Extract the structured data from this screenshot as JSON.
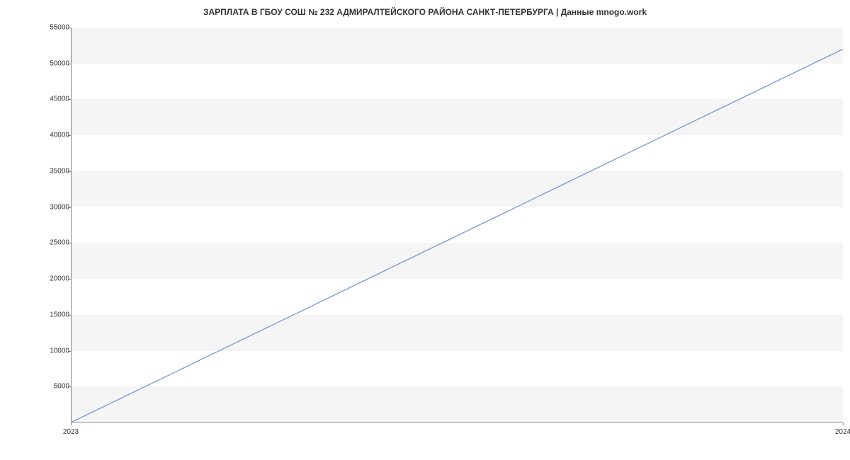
{
  "chart_data": {
    "type": "line",
    "title": "ЗАРПЛАТА В ГБОУ СОШ № 232 АДМИРАЛТЕЙСКОГО РАЙОНА САНКТ-ПЕТЕРБУРГА | Данные mnogo.work",
    "x": [
      2023,
      2024
    ],
    "values": [
      0,
      52000
    ],
    "xlabel": "",
    "ylabel": "",
    "xlim": [
      2023,
      2024
    ],
    "ylim": [
      0,
      55000
    ],
    "x_ticks": [
      "2023",
      "2024"
    ],
    "y_ticks": [
      5000,
      10000,
      15000,
      20000,
      25000,
      30000,
      35000,
      40000,
      45000,
      50000,
      55000
    ],
    "line_color": "#6b8fd6"
  }
}
